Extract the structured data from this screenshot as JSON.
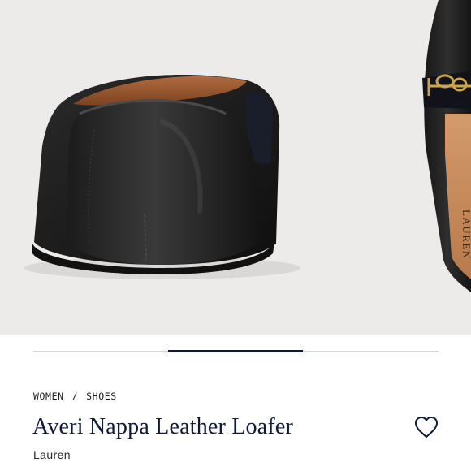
{
  "gallery": {
    "image_alt": "Averi Nappa Leather Loafer — rear view",
    "insole_brand_text": "LAUREN",
    "slide_count": 3,
    "active_slide": 2
  },
  "breadcrumb": {
    "items": [
      "WOMEN",
      "SHOES"
    ],
    "separator": "/"
  },
  "product": {
    "title": "Averi Nappa Leather Loafer",
    "brand": "Lauren"
  },
  "favorite": {
    "icon": "heart-outline-icon",
    "aria_label": "Add to wishlist"
  },
  "colors": {
    "background": "#ecebea",
    "accent_navy": "#0e1a36",
    "track": "#d6d6d6"
  }
}
